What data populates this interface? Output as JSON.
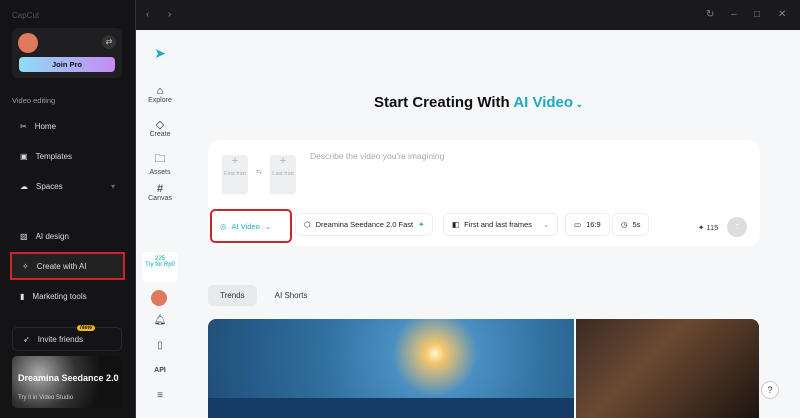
{
  "app": {
    "logo": "CapCut"
  },
  "sidebar": {
    "join_pro": "Join Pro",
    "section": "Video editing",
    "items": [
      {
        "label": "Home",
        "icon": "✂"
      },
      {
        "label": "Templates",
        "icon": "▣"
      },
      {
        "label": "Spaces",
        "icon": "☁"
      },
      {
        "label": "AI design",
        "icon": "▨"
      },
      {
        "label": "Create with AI",
        "icon": "✧"
      },
      {
        "label": "Marketing tools",
        "icon": "▮"
      }
    ],
    "invite": "Invite friends",
    "new_badge": "New",
    "promo": {
      "title": "Dreamina Seedance 2.0",
      "subtitle": "Try it in Video Studio"
    }
  },
  "rail": {
    "items": [
      "Explore",
      "Create",
      "Assets",
      "Canvas"
    ],
    "credits": "225",
    "try": "Try for Rp0",
    "api": "API"
  },
  "main": {
    "title": "Start Creating With",
    "title_accent": "AI Video",
    "first_frame": "First fran",
    "last_frame": "Last fran",
    "placeholder": "Describe the video you're imagining",
    "mode": "AI Video",
    "model": "Dreamina Seedance 2.0 Fast",
    "frames": "First and last frames",
    "ratio": "16:9",
    "duration": "5s",
    "cost": "115",
    "tabs": [
      "Trends",
      "AI Shorts"
    ]
  }
}
